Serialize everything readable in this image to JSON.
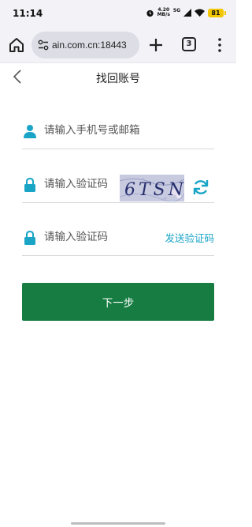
{
  "status_bar": {
    "time": "11:14",
    "net_speed_value": "4.20",
    "net_speed_unit": "MB/s",
    "network_type": "5G",
    "battery_level": "81"
  },
  "browser": {
    "url": "ain.com.cn:18443",
    "tab_count": "3"
  },
  "page": {
    "title": "找回账号"
  },
  "form": {
    "account_placeholder": "请输入手机号或邮箱",
    "captcha_placeholder": "请输入验证码",
    "captcha_text": "6TSN",
    "sms_placeholder": "请输入验证码",
    "send_code_label": "发送验证码",
    "next_label": "下一步"
  },
  "colors": {
    "accent": "#1aa5c7",
    "primary_button": "#167c42",
    "battery": "#f2c700"
  }
}
